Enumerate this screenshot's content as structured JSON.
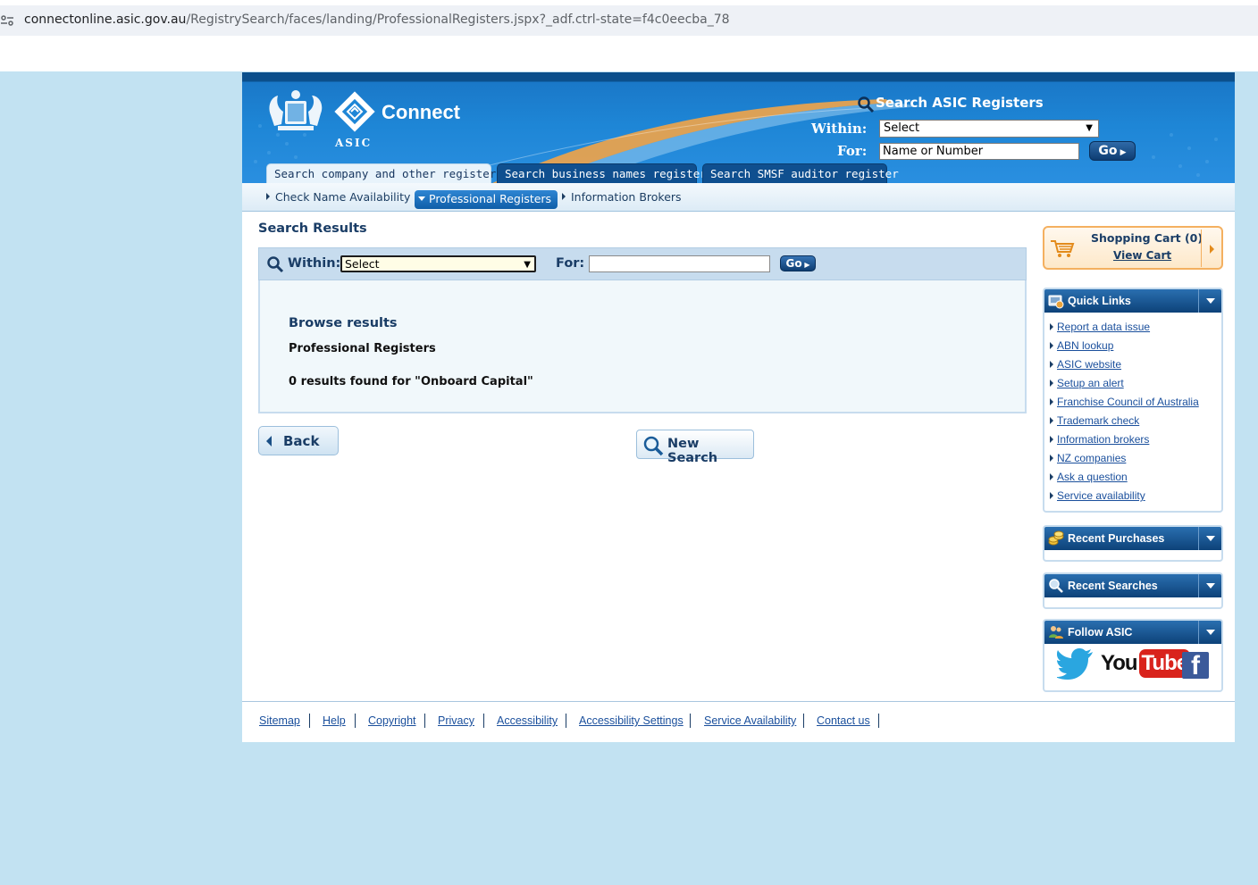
{
  "browser": {
    "url_host": "connectonline.asic.gov.au",
    "url_path": "/RegistrySearch/faces/landing/ProfessionalRegisters.jspx?_adf.ctrl-state=f4c0eecba_78"
  },
  "header": {
    "brand": "Connect",
    "brand_sub": "ASIC",
    "search_title": "Search ASIC Registers",
    "within_label": "Within:",
    "within_value": "Select",
    "for_label": "For:",
    "for_value": "Name or Number",
    "go_label": "Go"
  },
  "tabs": [
    {
      "label": "Search company and other registers",
      "active": true
    },
    {
      "label": "Search business names register",
      "active": false
    },
    {
      "label": "Search SMSF auditor register",
      "active": false
    }
  ],
  "subnav": [
    {
      "label": "Check Name Availability",
      "active": false
    },
    {
      "label": "Professional Registers",
      "active": true
    },
    {
      "label": "Information Brokers",
      "active": false
    }
  ],
  "main": {
    "title": "Search Results",
    "searchbar": {
      "within_label": "Within:",
      "within_value": "Select",
      "for_label": "For:",
      "for_value": "",
      "go_label": "Go"
    },
    "browse_title": "Browse results",
    "register_name": "Professional Registers",
    "result_text": "0 results found for \"Onboard Capital\"",
    "back_label": "Back",
    "new_search_label": "New Search"
  },
  "sidebar": {
    "cart_title": "Shopping Cart (0)",
    "cart_link": "View Cart",
    "quick_links_title": "Quick Links",
    "quick_links": [
      "Report a data issue",
      "ABN lookup",
      "ASIC website",
      "Setup an alert",
      "Franchise Council of Australia",
      "Trademark check",
      "Information brokers",
      "NZ companies",
      "Ask a question",
      "Service availability"
    ],
    "recent_purchases_title": "Recent Purchases",
    "recent_searches_title": "Recent Searches",
    "follow_title": "Follow ASIC",
    "social": {
      "youtube_you": "You",
      "youtube_tube": "Tube",
      "facebook": "f"
    }
  },
  "footer": {
    "links": [
      "Sitemap",
      "Help",
      "Copyright",
      "Privacy",
      "Accessibility",
      "Accessibility Settings",
      "Service Availability",
      "Contact us"
    ]
  },
  "colors": {
    "page_bg": "#c2e2f2",
    "header_blue": "#1e86d6",
    "navy": "#1a3d66",
    "link": "#1a4f9c",
    "cart_orange": "#f4b060"
  }
}
